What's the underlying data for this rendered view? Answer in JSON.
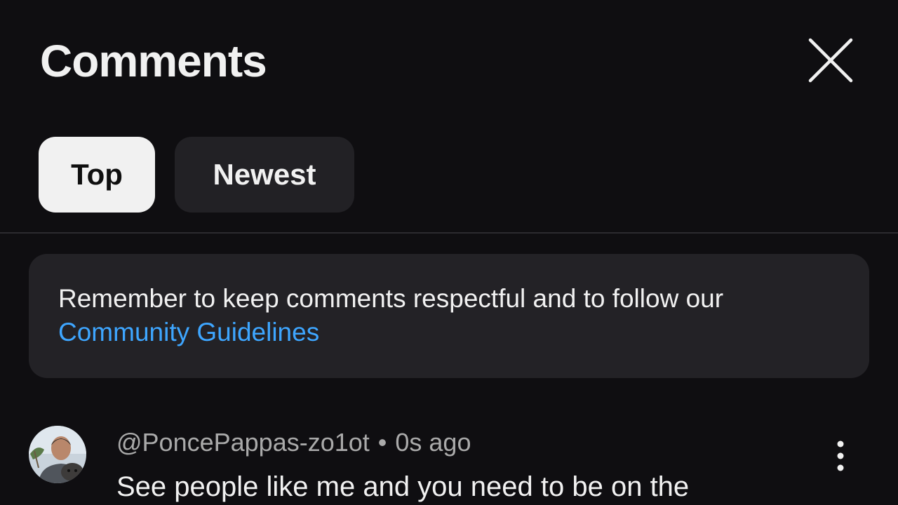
{
  "header": {
    "title": "Comments",
    "close_icon": "close-icon"
  },
  "sort_tabs": [
    {
      "label": "Top",
      "selected": true
    },
    {
      "label": "Newest",
      "selected": false
    }
  ],
  "notice": {
    "text": "Remember to keep comments respectful and to follow our ",
    "link_text": "Community Guidelines",
    "link_color": "#3ea6ff"
  },
  "comments": [
    {
      "author": "@PoncePappas-zo1ot",
      "separator": "•",
      "time": "0s ago",
      "text": "See people like me and you need to be on the",
      "more_icon": "more-vertical-icon"
    }
  ],
  "colors": {
    "background": "#0f0e11",
    "chip_selected_bg": "#f1f1f1",
    "chip_bg": "#222125",
    "notice_bg": "#232226",
    "secondary_text": "#aaaaaa"
  }
}
